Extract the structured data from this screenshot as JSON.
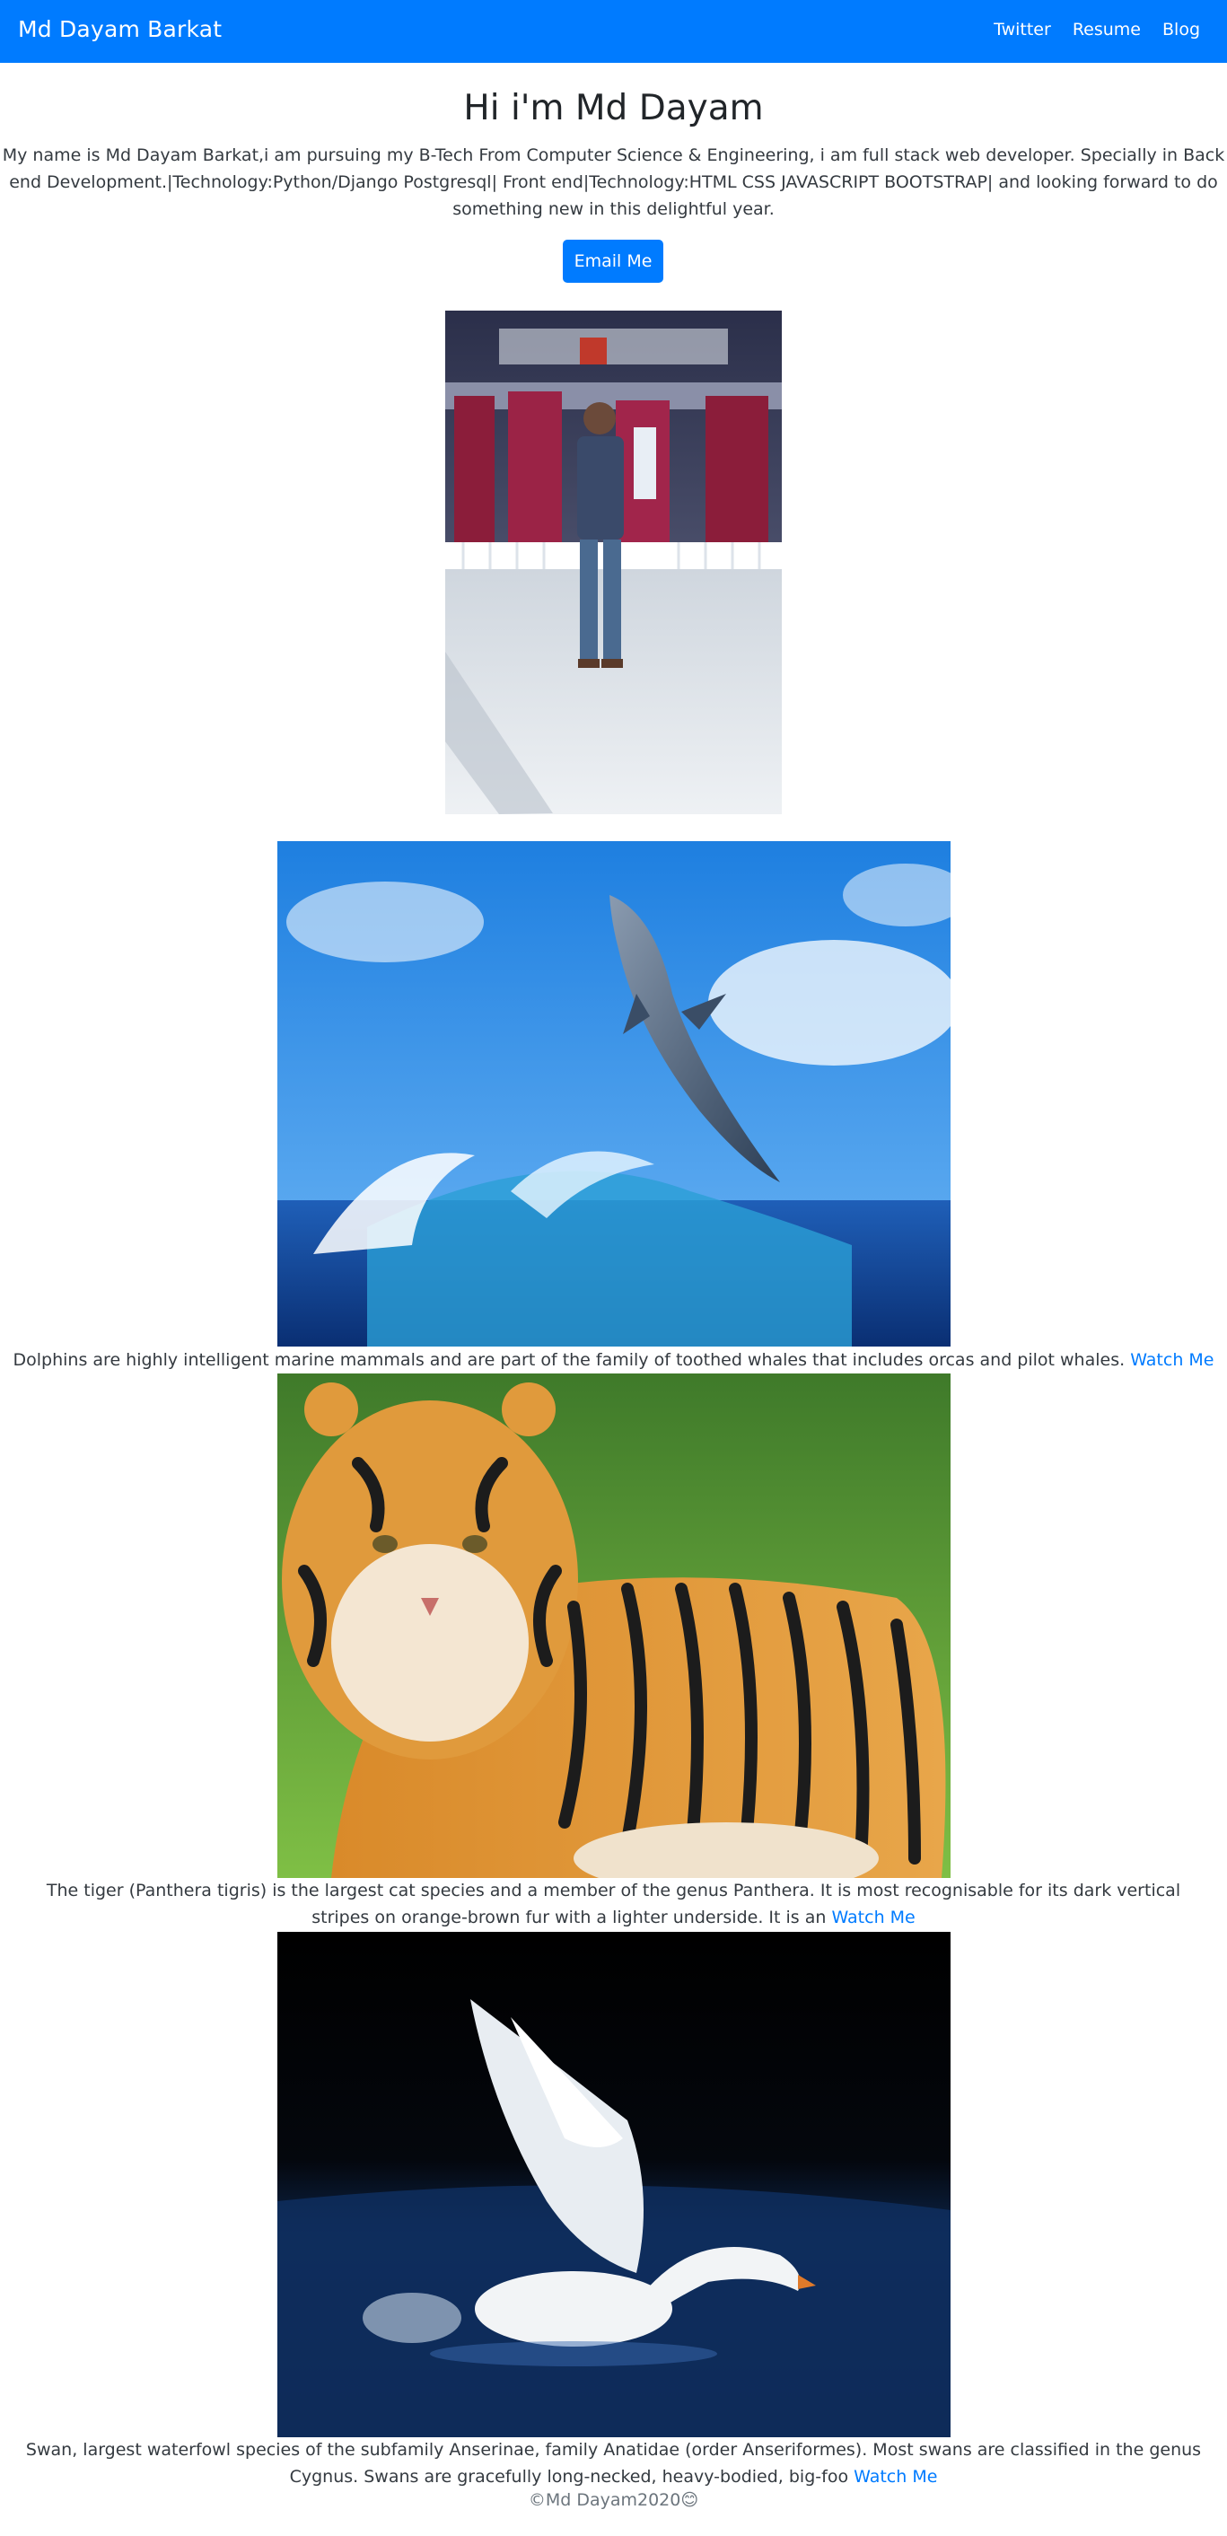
{
  "navbar": {
    "brand": "Md Dayam Barkat",
    "links": [
      "Twitter",
      "Resume",
      "Blog"
    ],
    "bg_color": "#007bff"
  },
  "hero": {
    "title": "Hi i'm Md Dayam",
    "description": "My name is Md Dayam Barkat,i am pursuing my B-Tech From Computer Science & Engineering, i am full stack web developer. Specially in Back end Development.|Technology:Python/Django Postgresql| Front end|Technology:HTML CSS JAVASCRIPT BOOTSTRAP| and looking forward to do something new in this delightful year.",
    "email_button": "Email Me"
  },
  "images": {
    "profile": "profile-photo",
    "dolphin": "dolphin-photo",
    "tiger": "tiger-photo",
    "swan": "swan-photo"
  },
  "cards": [
    {
      "text": "Dolphins are highly intelligent marine mammals and are part of the family of toothed whales that includes orcas and pilot whales.",
      "link": "Watch Me"
    },
    {
      "text": "The tiger (Panthera tigris) is the largest cat species and a member of the genus Panthera. It is most recognisable for its dark vertical stripes on orange-brown fur with a lighter underside. It is an",
      "link": "Watch Me"
    },
    {
      "text": "Swan, largest waterfowl species of the subfamily Anserinae, family Anatidae (order Anseriformes). Most swans are classified in the genus Cygnus. Swans are gracefully long-necked, heavy-bodied, big-foo",
      "link": "Watch Me"
    }
  ],
  "footer": {
    "text": "©Md Dayam2020",
    "emoji": "😊"
  },
  "colors": {
    "accent": "#007bff",
    "text": "#343a40",
    "muted": "#6c757d"
  }
}
